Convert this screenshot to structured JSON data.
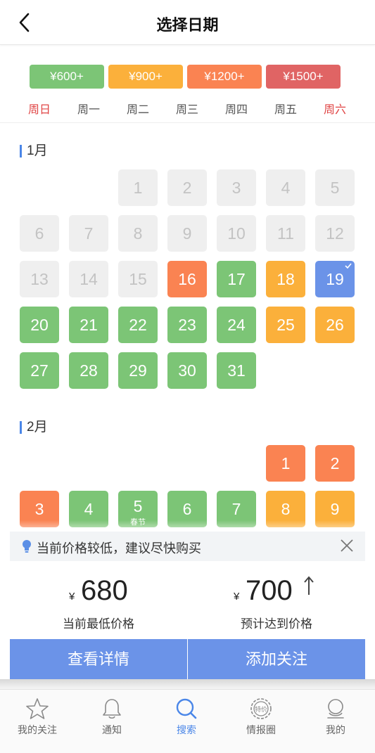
{
  "header": {
    "title": "选择日期",
    "back_icon": "chevron-left-icon"
  },
  "legend": [
    {
      "label": "¥600+",
      "color": "#7cc576"
    },
    {
      "label": "¥900+",
      "color": "#fbb03b"
    },
    {
      "label": "¥1200+",
      "color": "#fa8352"
    },
    {
      "label": "¥1500+",
      "color": "#e06464"
    }
  ],
  "weekdays": [
    "周日",
    "周一",
    "周二",
    "周三",
    "周四",
    "周五",
    "周六"
  ],
  "months": [
    {
      "title": "1月",
      "days": [
        {
          "d": "1",
          "state": "disabled"
        },
        {
          "d": "2",
          "state": "disabled"
        },
        {
          "d": "3",
          "state": "disabled"
        },
        {
          "d": "4",
          "state": "disabled"
        },
        {
          "d": "5",
          "state": "disabled"
        },
        {
          "d": "6",
          "state": "disabled"
        },
        {
          "d": "7",
          "state": "disabled"
        },
        {
          "d": "8",
          "state": "disabled"
        },
        {
          "d": "9",
          "state": "disabled"
        },
        {
          "d": "10",
          "state": "disabled"
        },
        {
          "d": "11",
          "state": "disabled"
        },
        {
          "d": "12",
          "state": "disabled"
        },
        {
          "d": "13",
          "state": "disabled"
        },
        {
          "d": "14",
          "state": "disabled"
        },
        {
          "d": "15",
          "state": "disabled"
        },
        {
          "d": "16",
          "state": "orange-red"
        },
        {
          "d": "17",
          "state": "green"
        },
        {
          "d": "18",
          "state": "orange"
        },
        {
          "d": "19",
          "state": "selected"
        },
        {
          "d": "20",
          "state": "green"
        },
        {
          "d": "21",
          "state": "green"
        },
        {
          "d": "22",
          "state": "green"
        },
        {
          "d": "23",
          "state": "green"
        },
        {
          "d": "24",
          "state": "green"
        },
        {
          "d": "25",
          "state": "orange"
        },
        {
          "d": "26",
          "state": "orange"
        },
        {
          "d": "27",
          "state": "green"
        },
        {
          "d": "28",
          "state": "green"
        },
        {
          "d": "29",
          "state": "green"
        },
        {
          "d": "30",
          "state": "green"
        },
        {
          "d": "31",
          "state": "green"
        }
      ]
    },
    {
      "title": "2月",
      "days": [
        {
          "d": "1",
          "state": "orange-red"
        },
        {
          "d": "2",
          "state": "orange-red"
        },
        {
          "d": "3",
          "state": "orange-red"
        },
        {
          "d": "4",
          "state": "green"
        },
        {
          "d": "5",
          "state": "green",
          "sub": "春节"
        },
        {
          "d": "6",
          "state": "green"
        },
        {
          "d": "7",
          "state": "green"
        },
        {
          "d": "8",
          "state": "orange"
        },
        {
          "d": "9",
          "state": "orange"
        }
      ]
    }
  ],
  "state_colors": {
    "green": "#7cc576",
    "orange": "#fbb03b",
    "orange-red": "#fa8352",
    "selected": "#6b93e8"
  },
  "tip": {
    "text": "当前价格较低，建议尽快购买",
    "icon": "lightbulb-icon",
    "close_icon": "close-icon"
  },
  "price": {
    "current": {
      "currency": "¥",
      "value": "680",
      "label": "当前最低价格"
    },
    "predicted": {
      "currency": "¥",
      "value": "700",
      "label": "预计达到价格",
      "trend_icon": "arrow-up-icon"
    }
  },
  "actions": {
    "details_label": "查看详情",
    "follow_label": "添加关注"
  },
  "tabs": [
    {
      "label": "我的关注",
      "icon": "star-icon",
      "active": false
    },
    {
      "label": "通知",
      "icon": "bell-icon",
      "active": false
    },
    {
      "label": "搜索",
      "icon": "search-icon",
      "active": true
    },
    {
      "label": "情报圈",
      "icon": "deal-badge-icon",
      "badge_text": "特价",
      "active": false
    },
    {
      "label": "我的",
      "icon": "user-icon",
      "active": false
    }
  ]
}
